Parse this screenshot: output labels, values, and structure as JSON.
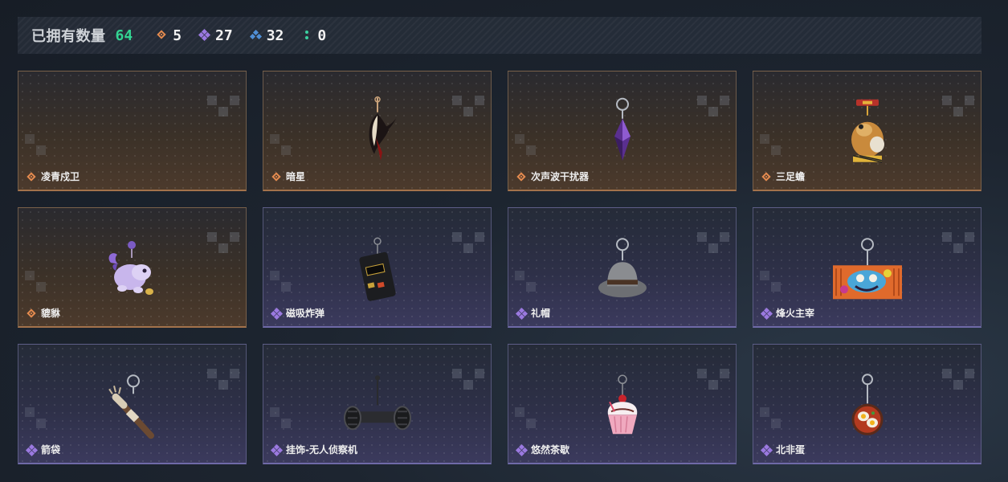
{
  "header": {
    "owned_label": "已拥有数量",
    "owned_total": "64",
    "counts": [
      {
        "rarity": "orange",
        "icon": "orange-rarity-icon",
        "value": "5",
        "color": "#e58b4f"
      },
      {
        "rarity": "purple",
        "icon": "purple-rarity-icon",
        "value": "27",
        "color": "#9b79e0"
      },
      {
        "rarity": "blue",
        "icon": "blue-rarity-icon",
        "value": "32",
        "color": "#4f8fd6"
      },
      {
        "rarity": "green",
        "icon": "green-rarity-icon",
        "value": "0",
        "color": "#3bd1a0"
      }
    ]
  },
  "items": [
    {
      "name": "凌青戍卫",
      "rarity": "orange",
      "art": "empty"
    },
    {
      "name": "暗星",
      "rarity": "orange",
      "art": "mask-charm"
    },
    {
      "name": "次声波干扰器",
      "rarity": "orange",
      "art": "crystal-charm"
    },
    {
      "name": "三足蟾",
      "rarity": "orange",
      "art": "toad-charm"
    },
    {
      "name": "貔貅",
      "rarity": "orange",
      "art": "pixiu-charm"
    },
    {
      "name": "磁吸炸弹",
      "rarity": "purple",
      "art": "bomb-charm"
    },
    {
      "name": "礼帽",
      "rarity": "purple",
      "art": "hat-charm"
    },
    {
      "name": "烽火主宰",
      "rarity": "purple",
      "art": "graffiti-charm"
    },
    {
      "name": "箭袋",
      "rarity": "purple",
      "art": "quiver-charm"
    },
    {
      "name": "挂饰-无人侦察机",
      "rarity": "purple",
      "art": "drone-charm"
    },
    {
      "name": "悠然茶歇",
      "rarity": "purple",
      "art": "cupcake-charm"
    },
    {
      "name": "北非蛋",
      "rarity": "purple",
      "art": "egg-pan-charm"
    }
  ]
}
